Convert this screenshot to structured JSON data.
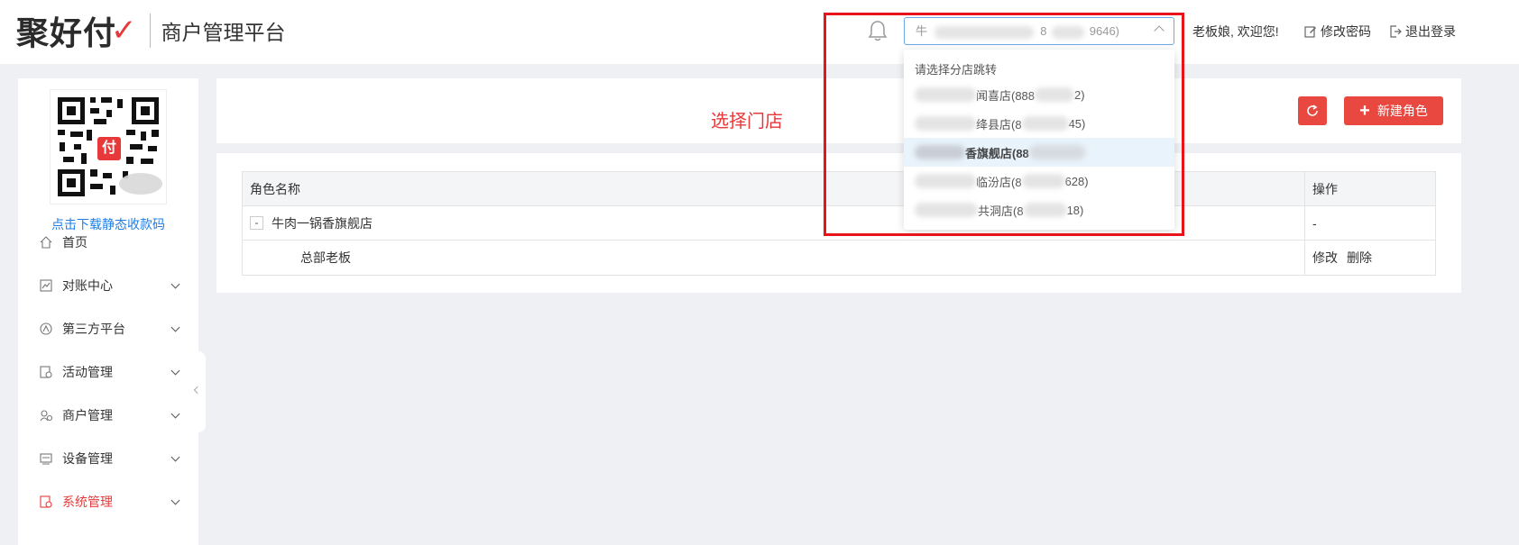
{
  "header": {
    "logo_text": "聚好付",
    "logo_mark": "✓",
    "platform_name": "商户管理平台",
    "store_select": {
      "prefix": "牛",
      "mid": "8",
      "suffix": "9646)"
    },
    "greeting": "老板娘, 欢迎您!",
    "change_password": "修改密码",
    "logout": "退出登录"
  },
  "sidebar": {
    "qr_badge": "付",
    "qr_download": "点击下载静态收款码",
    "items": [
      {
        "label": "首页",
        "icon": "home-icon",
        "has_children": false,
        "active": false
      },
      {
        "label": "对账中心",
        "icon": "chart-icon",
        "has_children": true,
        "active": false
      },
      {
        "label": "第三方平台",
        "icon": "platform-icon",
        "has_children": true,
        "active": false
      },
      {
        "label": "活动管理",
        "icon": "activity-icon",
        "has_children": true,
        "active": false
      },
      {
        "label": "商户管理",
        "icon": "merchant-icon",
        "has_children": true,
        "active": false
      },
      {
        "label": "设备管理",
        "icon": "device-icon",
        "has_children": true,
        "active": false
      },
      {
        "label": "系统管理",
        "icon": "system-icon",
        "has_children": true,
        "active": true
      }
    ]
  },
  "toolbar": {
    "annotation": "选择门店",
    "new_role_plus": "+",
    "new_role": "新建角色"
  },
  "table": {
    "columns": [
      "角色名称",
      "操作"
    ],
    "rows": [
      {
        "expander": "-",
        "name": "牛肉一锅香旗舰店",
        "ops": "-"
      },
      {
        "name": "总部老板",
        "edit": "修改",
        "delete": "删除"
      }
    ]
  },
  "dropdown": {
    "header": "请选择分店跳转",
    "items": [
      {
        "pre": "",
        "visible": "闻喜店(888",
        "post": "2)",
        "active": false
      },
      {
        "pre": "",
        "visible": "绛县店(8",
        "post": "45)",
        "active": false
      },
      {
        "pre": "",
        "visible": "香旗舰店(88",
        "post": "",
        "active": true
      },
      {
        "pre": "",
        "visible": "临汾店(8",
        "post": "628)",
        "active": false
      },
      {
        "pre": "",
        "visible": "共洞店(8",
        "post": "18)",
        "active": false
      }
    ]
  },
  "colors": {
    "accent": "#e8483f",
    "link": "#1f7fe6",
    "annotation": "#e8131b"
  }
}
